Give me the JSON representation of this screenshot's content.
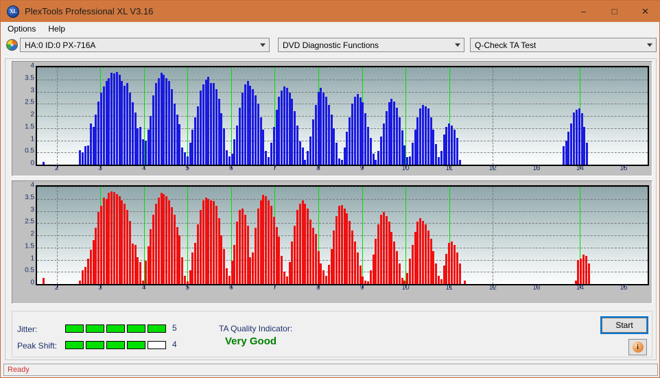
{
  "window": {
    "title": "PlexTools Professional XL V3.16",
    "icon": "xl-logo-icon",
    "minimize": "–",
    "maximize": "□",
    "close": "✕"
  },
  "menu": {
    "items": [
      {
        "label": "Options"
      },
      {
        "label": "Help"
      }
    ]
  },
  "selectors": {
    "drive": {
      "value": "HA:0 ID:0  PX-716A"
    },
    "function": {
      "value": "DVD Diagnostic Functions"
    },
    "test": {
      "value": "Q-Check TA Test"
    }
  },
  "results": {
    "jitter_label": "Jitter:",
    "jitter_value": "5",
    "jitter_filled": 5,
    "jitter_total": 5,
    "peak_shift_label": "Peak Shift:",
    "peak_shift_value": "4",
    "peak_shift_filled": 4,
    "peak_shift_total": 5,
    "ta_label": "TA Quality Indicator:",
    "ta_value": "Very Good",
    "ta_color": "#008000",
    "start_label": "Start",
    "info_label": "i"
  },
  "status": {
    "text": "Ready"
  },
  "colors": {
    "titlebar": "#d1783e",
    "jitter_bars": "#1a1ae0",
    "peak_bars": "#f01010",
    "marker_line": "#00e000",
    "axis_text": "#1b2f6b",
    "status_text": "#d03030"
  },
  "chart_data": [
    {
      "id": "jitter",
      "type": "bar",
      "title": "Jitter",
      "xlabel": "",
      "ylabel": "",
      "bar_color": "#1a1ae0",
      "marker_color": "#00e000",
      "markers": [
        3,
        4,
        5,
        6,
        7,
        8,
        9,
        10,
        11,
        14
      ],
      "xlim": [
        1.55,
        15.55
      ],
      "ylim": [
        0,
        4
      ],
      "xticks": [
        2,
        3,
        4,
        5,
        6,
        7,
        8,
        9,
        10,
        11,
        12,
        13,
        14,
        15
      ],
      "yticks": [
        0,
        0.5,
        1,
        1.5,
        2,
        2.5,
        3,
        3.5,
        4
      ],
      "grid": true,
      "x": [
        1.7,
        1.76,
        1.82,
        1.88,
        1.94,
        2.0,
        2.06,
        2.12,
        2.18,
        2.24,
        2.3,
        2.36,
        2.42,
        2.48,
        2.54,
        2.6,
        2.66,
        2.72,
        2.78,
        2.84,
        2.9,
        2.96,
        3.02,
        3.08,
        3.14,
        3.2,
        3.26,
        3.32,
        3.38,
        3.44,
        3.5,
        3.56,
        3.62,
        3.68,
        3.74,
        3.8,
        3.86,
        3.92,
        3.98,
        4.04,
        4.1,
        4.16,
        4.22,
        4.28,
        4.34,
        4.4,
        4.46,
        4.52,
        4.58,
        4.64,
        4.7,
        4.76,
        4.82,
        4.88,
        4.94,
        5.0,
        5.06,
        5.12,
        5.18,
        5.24,
        5.3,
        5.36,
        5.42,
        5.48,
        5.54,
        5.6,
        5.66,
        5.72,
        5.78,
        5.84,
        5.9,
        5.96,
        6.02,
        6.08,
        6.14,
        6.2,
        6.26,
        6.32,
        6.38,
        6.44,
        6.5,
        6.56,
        6.62,
        6.68,
        6.74,
        6.8,
        6.86,
        6.92,
        6.98,
        7.04,
        7.1,
        7.16,
        7.22,
        7.28,
        7.34,
        7.4,
        7.46,
        7.52,
        7.58,
        7.64,
        7.7,
        7.76,
        7.82,
        7.88,
        7.94,
        8.0,
        8.06,
        8.12,
        8.18,
        8.24,
        8.3,
        8.36,
        8.42,
        8.48,
        8.54,
        8.6,
        8.66,
        8.72,
        8.78,
        8.84,
        8.9,
        8.96,
        9.02,
        9.08,
        9.14,
        9.2,
        9.26,
        9.32,
        9.38,
        9.44,
        9.5,
        9.56,
        9.62,
        9.68,
        9.74,
        9.8,
        9.86,
        9.92,
        9.98,
        10.04,
        10.1,
        10.16,
        10.22,
        10.28,
        10.34,
        10.4,
        10.46,
        10.52,
        10.58,
        10.64,
        10.7,
        10.76,
        10.82,
        10.88,
        10.94,
        11.0,
        11.06,
        11.12,
        11.18,
        11.24,
        13.62,
        13.68,
        13.74,
        13.8,
        13.86,
        13.92,
        13.98,
        14.04,
        14.1,
        14.16
      ],
      "values": [
        0.1,
        0,
        0,
        0,
        0,
        0,
        0,
        0,
        0,
        0,
        0,
        0,
        0,
        0,
        0.6,
        0.5,
        0.75,
        0.8,
        1.7,
        1.55,
        2.05,
        2.6,
        2.95,
        3.2,
        3.45,
        3.55,
        3.78,
        3.75,
        3.8,
        3.7,
        3.45,
        3.25,
        3.35,
        2.95,
        2.55,
        2.15,
        1.5,
        1.55,
        1.05,
        1.0,
        1.45,
        2.0,
        2.85,
        3.35,
        3.55,
        3.78,
        3.7,
        3.55,
        3.45,
        3.1,
        2.5,
        2.05,
        1.65,
        0.7,
        0.5,
        0.35,
        0.9,
        1.45,
        1.95,
        2.4,
        3.05,
        3.3,
        3.5,
        3.6,
        3.35,
        3.35,
        3.1,
        2.7,
        2.1,
        1.5,
        0.6,
        0.35,
        0.45,
        1.05,
        1.6,
        2.35,
        2.95,
        3.3,
        3.45,
        3.25,
        3.1,
        2.85,
        2.5,
        1.95,
        1.45,
        0.55,
        0.3,
        0.9,
        1.55,
        2.25,
        2.8,
        3.05,
        3.2,
        3.15,
        2.95,
        2.7,
        2.2,
        1.6,
        0.95,
        0.7,
        0.2,
        0.55,
        1.15,
        1.85,
        2.45,
        3.0,
        3.15,
        2.95,
        2.8,
        2.45,
        2.05,
        1.5,
        0.9,
        0.25,
        0.2,
        0.7,
        1.35,
        1.95,
        2.5,
        2.8,
        2.9,
        2.75,
        2.55,
        2.1,
        1.55,
        1.1,
        0.45,
        0.2,
        0.55,
        1.15,
        1.7,
        2.2,
        2.55,
        2.7,
        2.6,
        2.35,
        1.95,
        1.4,
        0.8,
        0.3,
        0.35,
        0.9,
        1.45,
        1.95,
        2.3,
        2.45,
        2.4,
        2.3,
        1.95,
        1.45,
        0.85,
        0.3,
        0.55,
        1.25,
        1.55,
        1.7,
        1.6,
        1.45,
        1.1,
        0.2,
        0.75,
        1.0,
        1.35,
        1.7,
        2.15,
        2.25,
        2.3,
        2.1,
        1.55,
        0.9
      ]
    },
    {
      "id": "peak-shift",
      "type": "bar",
      "title": "Peak Shift",
      "xlabel": "",
      "ylabel": "",
      "bar_color": "#f01010",
      "marker_color": "#00e000",
      "markers": [
        3,
        4,
        5,
        6,
        7,
        8,
        9,
        10,
        11,
        14
      ],
      "xlim": [
        1.55,
        15.55
      ],
      "ylim": [
        0,
        4
      ],
      "xticks": [
        2,
        3,
        4,
        5,
        6,
        7,
        8,
        9,
        10,
        11,
        12,
        13,
        14,
        15
      ],
      "yticks": [
        0,
        0.5,
        1,
        1.5,
        2,
        2.5,
        3,
        3.5,
        4
      ],
      "grid": true,
      "x": [
        1.7,
        1.76,
        1.82,
        1.88,
        1.94,
        2.0,
        2.06,
        2.12,
        2.18,
        2.24,
        2.3,
        2.36,
        2.42,
        2.48,
        2.54,
        2.6,
        2.66,
        2.72,
        2.78,
        2.84,
        2.9,
        2.96,
        3.02,
        3.08,
        3.14,
        3.2,
        3.26,
        3.32,
        3.38,
        3.44,
        3.5,
        3.56,
        3.62,
        3.68,
        3.74,
        3.8,
        3.86,
        3.92,
        3.98,
        4.04,
        4.1,
        4.16,
        4.22,
        4.28,
        4.34,
        4.4,
        4.46,
        4.52,
        4.58,
        4.64,
        4.7,
        4.76,
        4.82,
        4.88,
        4.94,
        5.0,
        5.06,
        5.12,
        5.18,
        5.24,
        5.3,
        5.36,
        5.42,
        5.48,
        5.54,
        5.6,
        5.66,
        5.72,
        5.78,
        5.84,
        5.9,
        5.96,
        6.02,
        6.08,
        6.14,
        6.2,
        6.26,
        6.32,
        6.38,
        6.44,
        6.5,
        6.56,
        6.62,
        6.68,
        6.74,
        6.8,
        6.86,
        6.92,
        6.98,
        7.04,
        7.1,
        7.16,
        7.22,
        7.28,
        7.34,
        7.4,
        7.46,
        7.52,
        7.58,
        7.64,
        7.7,
        7.76,
        7.82,
        7.88,
        7.94,
        8.0,
        8.06,
        8.12,
        8.18,
        8.24,
        8.3,
        8.36,
        8.42,
        8.48,
        8.54,
        8.6,
        8.66,
        8.72,
        8.78,
        8.84,
        8.9,
        8.96,
        9.02,
        9.08,
        9.14,
        9.2,
        9.26,
        9.32,
        9.38,
        9.44,
        9.5,
        9.56,
        9.62,
        9.68,
        9.74,
        9.8,
        9.86,
        9.92,
        9.98,
        10.04,
        10.1,
        10.16,
        10.22,
        10.28,
        10.34,
        10.4,
        10.46,
        10.52,
        10.58,
        10.64,
        10.7,
        10.76,
        10.82,
        10.88,
        10.94,
        11.0,
        11.06,
        11.12,
        11.18,
        11.24,
        11.36,
        13.9,
        13.96,
        14.02,
        14.08,
        14.14,
        14.2
      ],
      "values": [
        0.25,
        0,
        0,
        0,
        0,
        0,
        0,
        0,
        0,
        0,
        0,
        0,
        0,
        0,
        0.15,
        0.55,
        0.7,
        1.05,
        1.4,
        1.8,
        2.3,
        2.95,
        3.2,
        3.55,
        3.5,
        3.75,
        3.8,
        3.78,
        3.7,
        3.6,
        3.45,
        3.3,
        3.05,
        2.6,
        1.65,
        1.6,
        1.1,
        0.9,
        0.15,
        0.95,
        1.55,
        2.25,
        2.85,
        3.3,
        3.55,
        3.75,
        3.7,
        3.6,
        3.45,
        3.15,
        2.85,
        2.35,
        2.0,
        1.1,
        0.35,
        0.1,
        0.55,
        1.3,
        1.7,
        2.45,
        3.05,
        3.45,
        3.55,
        3.5,
        3.45,
        3.4,
        3.2,
        2.7,
        2.0,
        1.45,
        0.65,
        0.35,
        0.95,
        1.6,
        2.55,
        3.05,
        3.1,
        2.85,
        2.4,
        1.1,
        1.3,
        2.3,
        3.1,
        3.45,
        3.65,
        3.6,
        3.45,
        3.2,
        2.75,
        2.35,
        1.95,
        1.15,
        0.5,
        0.3,
        0.9,
        1.75,
        2.4,
        3.05,
        3.3,
        3.45,
        3.3,
        3.1,
        2.65,
        2.3,
        2.05,
        1.35,
        0.85,
        0.55,
        0.35,
        0.8,
        1.45,
        2.2,
        2.8,
        3.2,
        3.25,
        3.1,
        2.9,
        2.6,
        2.2,
        1.75,
        1.3,
        0.75,
        0.3,
        0.15,
        0.1,
        0.55,
        1.2,
        1.85,
        2.45,
        2.85,
        2.95,
        2.8,
        2.55,
        2.15,
        1.75,
        1.35,
        0.85,
        0.25,
        0.15,
        0.45,
        1.05,
        1.6,
        2.15,
        2.55,
        2.7,
        2.6,
        2.45,
        2.2,
        1.85,
        1.35,
        0.85,
        0.35,
        0.2,
        0.75,
        1.25,
        1.7,
        1.75,
        1.6,
        1.3,
        0.85,
        0.15,
        0.15,
        1.0,
        1.05,
        1.2,
        1.15,
        0.85
      ]
    }
  ]
}
